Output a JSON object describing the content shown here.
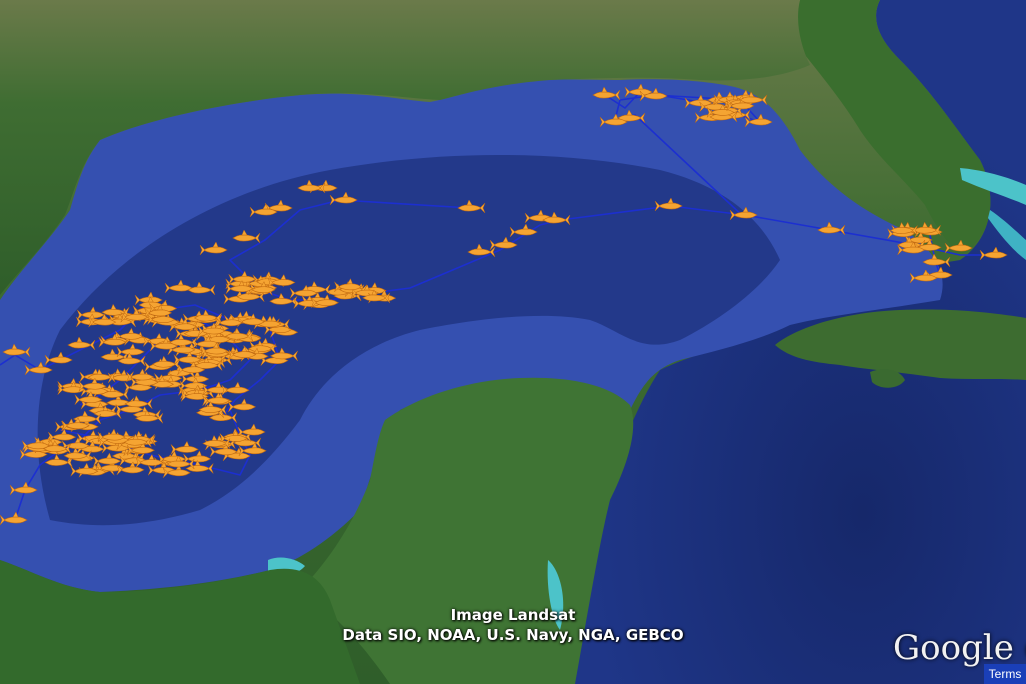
{
  "imagery_credit": "Image Landsat",
  "data_credit": "Data SIO, NOAA, U.S. Navy, NGA, GEBCO",
  "logo_text": "Google e",
  "terms_label": "Terms",
  "colors": {
    "track_line": "#1c2fd0",
    "marker_fill": "#f5a432",
    "marker_edge": "#c26a10",
    "deep_water": "#1b2f78",
    "shelf_water": "#3a56b4",
    "land": "#3d6e32"
  },
  "marker_icon": "shark-icon"
}
